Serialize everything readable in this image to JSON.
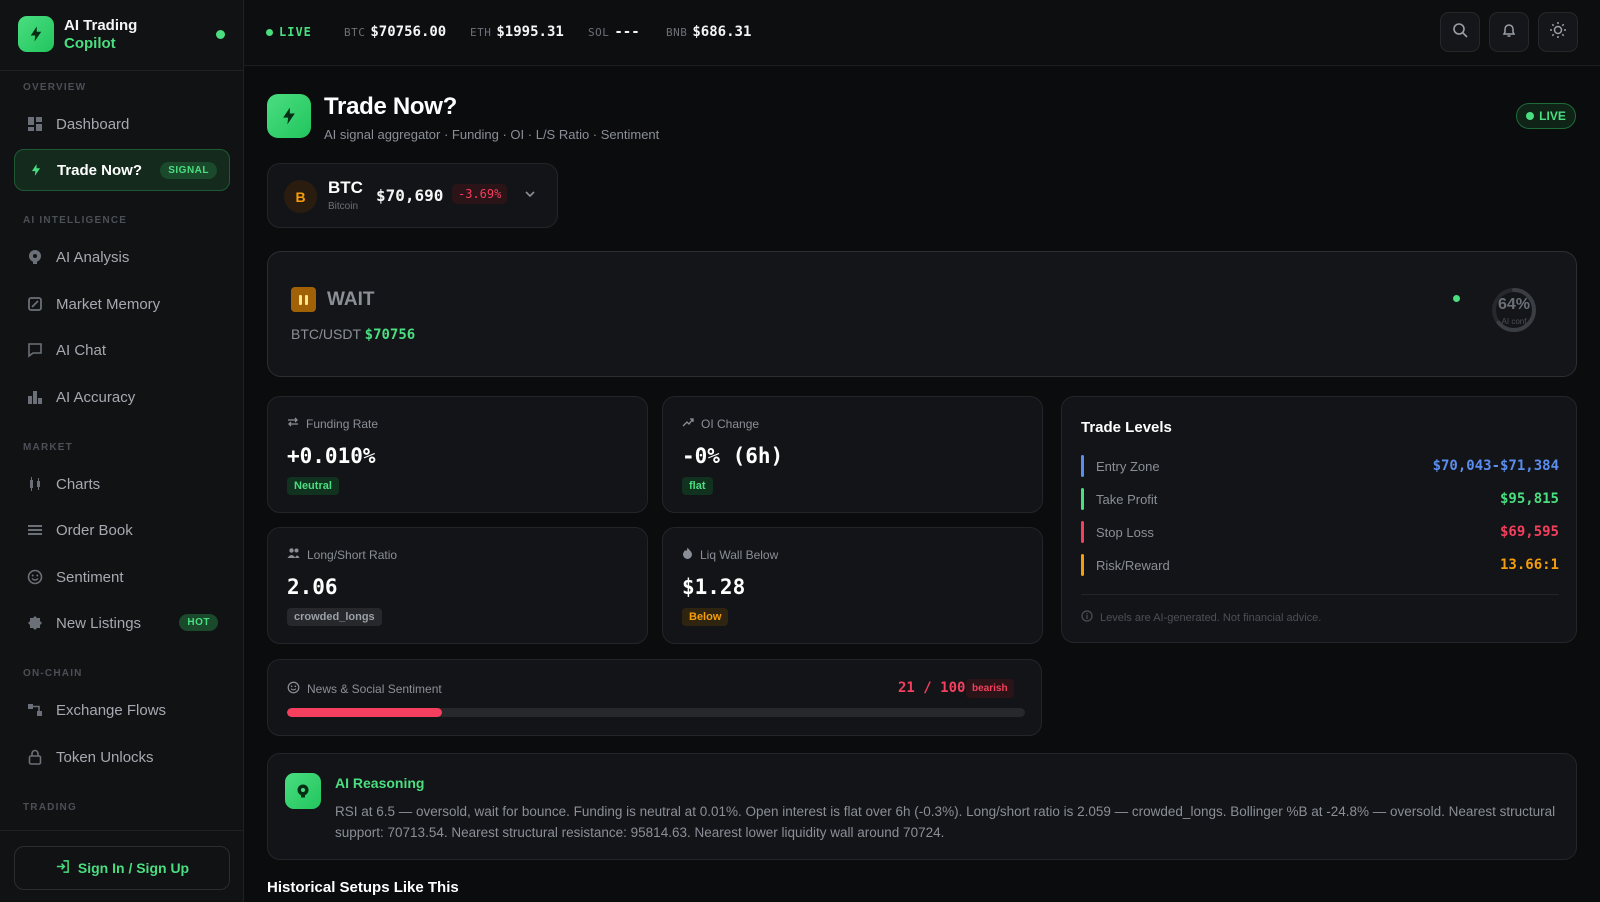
{
  "brand": {
    "title": "AI Trading",
    "subtitle": "Copilot"
  },
  "sidebar": {
    "sections": [
      {
        "label": "OVERVIEW"
      },
      {
        "label": "AI INTELLIGENCE"
      },
      {
        "label": "MARKET"
      },
      {
        "label": "ON-CHAIN"
      },
      {
        "label": "TRADING"
      }
    ],
    "items": [
      {
        "label": "Dashboard",
        "icon": "grid-icon"
      },
      {
        "label": "Trade Now?",
        "icon": "bolt-icon",
        "badge": "SIGNAL",
        "active": true
      },
      {
        "label": "AI Analysis",
        "icon": "brain-icon"
      },
      {
        "label": "Market Memory",
        "icon": "history-icon"
      },
      {
        "label": "AI Chat",
        "icon": "chat-icon"
      },
      {
        "label": "AI Accuracy",
        "icon": "bar-chart-icon"
      },
      {
        "label": "Charts",
        "icon": "candles-icon"
      },
      {
        "label": "Order Book",
        "icon": "list-icon"
      },
      {
        "label": "Sentiment",
        "icon": "smile-icon"
      },
      {
        "label": "New Listings",
        "icon": "badge-icon",
        "badge": "HOT"
      },
      {
        "label": "Exchange Flows",
        "icon": "flow-icon"
      },
      {
        "label": "Token Unlocks",
        "icon": "lock-icon"
      }
    ],
    "signin_label": "Sign In / Sign Up"
  },
  "topbar": {
    "live_label": "LIVE",
    "tickers": [
      {
        "symbol": "BTC",
        "price": "$70756.00"
      },
      {
        "symbol": "ETH",
        "price": "$1995.31"
      },
      {
        "symbol": "SOL",
        "price": "---"
      },
      {
        "symbol": "BNB",
        "price": "$686.31"
      }
    ]
  },
  "page": {
    "title": "Trade Now?",
    "subtitle": "AI signal aggregator · Funding · OI · L/S Ratio · Sentiment",
    "live_label": "LIVE"
  },
  "asset": {
    "avatar": "B",
    "symbol": "BTC",
    "name": "Bitcoin",
    "price": "$70,690",
    "change": "-3.69%"
  },
  "signal": {
    "action": "WAIT",
    "pair": "BTC/USDT",
    "pair_price": "$70756",
    "confidence_pct": 64,
    "confidence_label": "64%",
    "confidence_caption": "AI conf"
  },
  "metrics": {
    "funding": {
      "label": "Funding Rate",
      "value": "+0.010%",
      "tag": "Neutral"
    },
    "oi": {
      "label": "OI Change",
      "value": "-0% (6h)",
      "tag": "flat"
    },
    "ls": {
      "label": "Long/Short Ratio",
      "value": "2.06",
      "tag": "crowded_longs"
    },
    "liq": {
      "label": "Liq Wall Below",
      "value": "$1.28",
      "tag": "Below"
    }
  },
  "levels": {
    "title": "Trade Levels",
    "rows": [
      {
        "label": "Entry Zone",
        "value": "$70,043-$71,384",
        "color": "#5b8def"
      },
      {
        "label": "Take Profit",
        "value": "$95,815",
        "color": "#4ade80"
      },
      {
        "label": "Stop Loss",
        "value": "$69,595",
        "color": "#f43f5e"
      },
      {
        "label": "Risk/Reward",
        "value": "13.66:1",
        "color": "#f59e0b"
      }
    ],
    "note": "Levels are AI-generated. Not financial advice."
  },
  "sentiment": {
    "label": "News & Social Sentiment",
    "score": "21 / 100",
    "score_value": 21,
    "tag": "bearish"
  },
  "reasoning": {
    "title": "AI Reasoning",
    "text": "RSI at 6.5 — oversold, wait for bounce. Funding is neutral at 0.01%. Open interest is flat over 6h (-0.3%). Long/short ratio is 2.059 — crowded_longs. Bollinger %B at -24.8% — oversold. Nearest structural support: 70713.54. Nearest structural resistance: 95814.63. Nearest lower liquidity wall around 70724."
  },
  "history": {
    "title": "Historical Setups Like This"
  }
}
